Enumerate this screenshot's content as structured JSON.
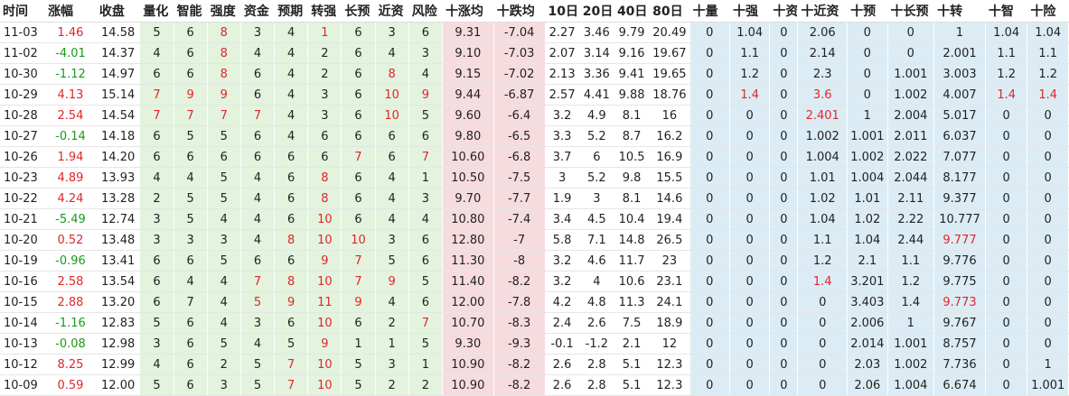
{
  "headers": [
    "时间",
    "涨幅",
    "收盘",
    "量化",
    "智能",
    "强度",
    "资金",
    "预期",
    "转强",
    "长预",
    "近资",
    "风险",
    "十涨均",
    "十跌均",
    "10日",
    "20日",
    "40日",
    "80日",
    "十量",
    "十强",
    "十资",
    "十近资",
    "十预",
    "十长预",
    "十转",
    "十智",
    "十险"
  ],
  "colors": {
    "positive": "#e0262a",
    "negative": "#1a9a1a",
    "green_bg": "#e3f3de",
    "pink_bg": "#f6dcdf",
    "blue_bg": "#dcecf4"
  },
  "rows": [
    [
      "11-03",
      "1.46",
      "14.58",
      "5",
      "6",
      "8",
      "3",
      "4",
      "1",
      "6",
      "3",
      "6",
      "9.31",
      "-7.04",
      "2.27",
      "3.46",
      "9.79",
      "20.49",
      "0",
      "1.04",
      "0",
      "2.06",
      "0",
      "0",
      "1",
      "1.04",
      "1.04"
    ],
    [
      "11-02",
      "-4.01",
      "14.37",
      "4",
      "6",
      "8",
      "4",
      "4",
      "2",
      "6",
      "4",
      "3",
      "9.10",
      "-7.03",
      "2.07",
      "3.14",
      "9.16",
      "19.67",
      "0",
      "1.1",
      "0",
      "2.14",
      "0",
      "0",
      "2.001",
      "1.1",
      "1.1"
    ],
    [
      "10-30",
      "-1.12",
      "14.97",
      "6",
      "6",
      "8",
      "6",
      "4",
      "2",
      "6",
      "8",
      "4",
      "9.15",
      "-7.02",
      "2.13",
      "3.36",
      "9.41",
      "19.65",
      "0",
      "1.2",
      "0",
      "2.3",
      "0",
      "1.001",
      "3.003",
      "1.2",
      "1.2"
    ],
    [
      "10-29",
      "4.13",
      "15.14",
      "7",
      "9",
      "9",
      "6",
      "4",
      "3",
      "6",
      "10",
      "9",
      "9.44",
      "-6.87",
      "2.57",
      "4.41",
      "9.88",
      "18.76",
      "0",
      "1.4",
      "0",
      "3.6",
      "0",
      "1.002",
      "4.007",
      "1.4",
      "1.4"
    ],
    [
      "10-28",
      "2.54",
      "14.54",
      "7",
      "7",
      "7",
      "7",
      "4",
      "3",
      "6",
      "10",
      "5",
      "9.60",
      "-6.4",
      "3.2",
      "4.9",
      "8.1",
      "16",
      "0",
      "0",
      "0",
      "2.401",
      "1",
      "2.004",
      "5.017",
      "0",
      "0"
    ],
    [
      "10-27",
      "-0.14",
      "14.18",
      "6",
      "5",
      "5",
      "6",
      "4",
      "6",
      "6",
      "6",
      "6",
      "9.80",
      "-6.5",
      "3.3",
      "5.2",
      "8.7",
      "16.2",
      "0",
      "0",
      "0",
      "1.002",
      "1.001",
      "2.011",
      "6.037",
      "0",
      "0"
    ],
    [
      "10-26",
      "1.94",
      "14.20",
      "6",
      "6",
      "6",
      "6",
      "6",
      "6",
      "7",
      "6",
      "7",
      "10.60",
      "-6.8",
      "3.7",
      "6",
      "10.5",
      "16.9",
      "0",
      "0",
      "0",
      "1.004",
      "1.002",
      "2.022",
      "7.077",
      "0",
      "0"
    ],
    [
      "10-23",
      "4.89",
      "13.93",
      "4",
      "4",
      "5",
      "4",
      "6",
      "8",
      "6",
      "4",
      "1",
      "10.50",
      "-7.5",
      "3",
      "5.2",
      "9.8",
      "15.5",
      "0",
      "0",
      "0",
      "1.01",
      "1.004",
      "2.044",
      "8.177",
      "0",
      "0"
    ],
    [
      "10-22",
      "4.24",
      "13.28",
      "2",
      "5",
      "5",
      "4",
      "6",
      "8",
      "6",
      "4",
      "3",
      "9.70",
      "-7.7",
      "1.9",
      "3",
      "8.1",
      "14.6",
      "0",
      "0",
      "0",
      "1.02",
      "1.01",
      "2.11",
      "9.377",
      "0",
      "0"
    ],
    [
      "10-21",
      "-5.49",
      "12.74",
      "3",
      "5",
      "4",
      "4",
      "6",
      "10",
      "6",
      "4",
      "4",
      "10.80",
      "-7.4",
      "3.4",
      "4.5",
      "10.4",
      "19.4",
      "0",
      "0",
      "0",
      "1.04",
      "1.02",
      "2.22",
      "10.777",
      "0",
      "0"
    ],
    [
      "10-20",
      "0.52",
      "13.48",
      "3",
      "3",
      "3",
      "4",
      "8",
      "10",
      "10",
      "3",
      "6",
      "12.80",
      "-7",
      "5.8",
      "7.1",
      "14.8",
      "26.5",
      "0",
      "0",
      "0",
      "1.1",
      "1.04",
      "2.44",
      "9.777",
      "0",
      "0"
    ],
    [
      "10-19",
      "-0.96",
      "13.41",
      "6",
      "6",
      "5",
      "6",
      "6",
      "9",
      "7",
      "5",
      "6",
      "11.30",
      "-8",
      "3.2",
      "4.6",
      "11.7",
      "23",
      "0",
      "0",
      "0",
      "1.2",
      "2.1",
      "1.1",
      "9.776",
      "0",
      "0"
    ],
    [
      "10-16",
      "2.58",
      "13.54",
      "6",
      "4",
      "4",
      "7",
      "8",
      "10",
      "7",
      "9",
      "5",
      "11.40",
      "-8.2",
      "3.2",
      "4",
      "10.6",
      "23.1",
      "0",
      "0",
      "0",
      "1.4",
      "3.201",
      "1.2",
      "9.775",
      "0",
      "0"
    ],
    [
      "10-15",
      "2.88",
      "13.20",
      "6",
      "7",
      "4",
      "5",
      "9",
      "11",
      "9",
      "4",
      "6",
      "12.00",
      "-7.8",
      "4.2",
      "4.8",
      "11.3",
      "24.1",
      "0",
      "0",
      "0",
      "0",
      "3.403",
      "1.4",
      "9.773",
      "0",
      "0"
    ],
    [
      "10-14",
      "-1.16",
      "12.83",
      "5",
      "6",
      "4",
      "3",
      "6",
      "10",
      "6",
      "2",
      "7",
      "10.70",
      "-8.3",
      "2.4",
      "2.6",
      "7.5",
      "18.9",
      "0",
      "0",
      "0",
      "0",
      "2.006",
      "1",
      "9.767",
      "0",
      "0"
    ],
    [
      "10-13",
      "-0.08",
      "12.98",
      "3",
      "6",
      "5",
      "4",
      "5",
      "9",
      "1",
      "1",
      "5",
      "9.30",
      "-9.3",
      "-0.1",
      "-1.2",
      "2.1",
      "12",
      "0",
      "0",
      "0",
      "0",
      "2.014",
      "1.001",
      "8.757",
      "0",
      "0"
    ],
    [
      "10-12",
      "8.25",
      "12.99",
      "4",
      "6",
      "2",
      "5",
      "7",
      "10",
      "5",
      "3",
      "1",
      "10.90",
      "-8.2",
      "2.6",
      "2.8",
      "5.1",
      "12.3",
      "0",
      "0",
      "0",
      "0",
      "2.03",
      "1.002",
      "7.736",
      "0",
      "1"
    ],
    [
      "10-09",
      "0.59",
      "12.00",
      "5",
      "6",
      "3",
      "5",
      "7",
      "10",
      "5",
      "2",
      "2",
      "10.90",
      "-8.2",
      "2.6",
      "2.8",
      "5.1",
      "12.3",
      "0",
      "0",
      "0",
      "0",
      "2.06",
      "1.004",
      "6.674",
      "0",
      "1.001"
    ]
  ],
  "red_cells": [
    [
      0,
      5
    ],
    [
      0,
      8
    ],
    [
      1,
      5
    ],
    [
      2,
      5
    ],
    [
      2,
      10
    ],
    [
      3,
      3
    ],
    [
      3,
      4
    ],
    [
      3,
      5
    ],
    [
      3,
      10
    ],
    [
      3,
      11
    ],
    [
      3,
      19
    ],
    [
      3,
      21
    ],
    [
      3,
      25
    ],
    [
      3,
      26
    ],
    [
      4,
      3
    ],
    [
      4,
      4
    ],
    [
      4,
      5
    ],
    [
      4,
      6
    ],
    [
      4,
      10
    ],
    [
      4,
      21
    ],
    [
      6,
      9
    ],
    [
      6,
      11
    ],
    [
      7,
      8
    ],
    [
      8,
      8
    ],
    [
      9,
      8
    ],
    [
      10,
      7
    ],
    [
      10,
      8
    ],
    [
      10,
      9
    ],
    [
      10,
      24
    ],
    [
      11,
      8
    ],
    [
      11,
      9
    ],
    [
      12,
      6
    ],
    [
      12,
      7
    ],
    [
      12,
      8
    ],
    [
      12,
      9
    ],
    [
      12,
      10
    ],
    [
      12,
      21
    ],
    [
      13,
      6
    ],
    [
      13,
      7
    ],
    [
      13,
      8
    ],
    [
      13,
      9
    ],
    [
      13,
      24
    ],
    [
      14,
      8
    ],
    [
      14,
      11
    ],
    [
      15,
      8
    ],
    [
      16,
      7
    ],
    [
      16,
      8
    ],
    [
      17,
      7
    ],
    [
      17,
      8
    ]
  ]
}
